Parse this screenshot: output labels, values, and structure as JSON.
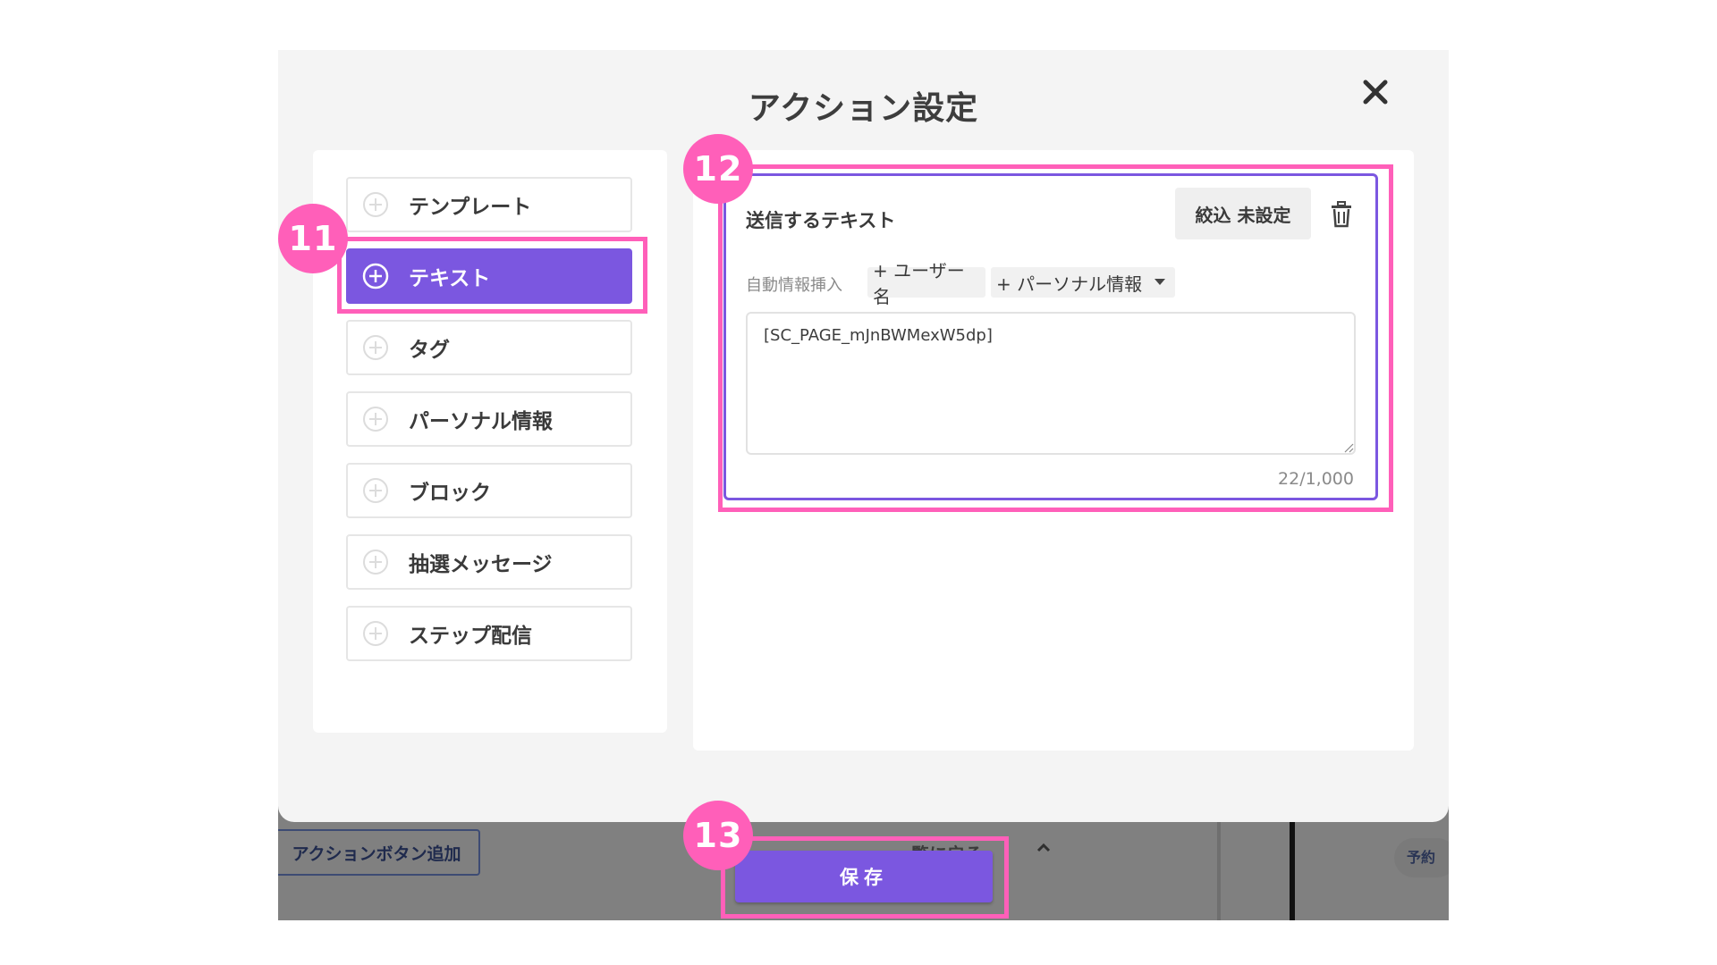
{
  "modal": {
    "title": "アクション設定"
  },
  "left_menu": {
    "items": [
      {
        "label": "テンプレート",
        "active": false
      },
      {
        "label": "テキスト",
        "active": true
      },
      {
        "label": "タグ",
        "active": false
      },
      {
        "label": "パーソナル情報",
        "active": false
      },
      {
        "label": "ブロック",
        "active": false
      },
      {
        "label": "抽選メッセージ",
        "active": false
      },
      {
        "label": "ステップ配信",
        "active": false
      }
    ]
  },
  "text_card": {
    "title": "送信するテキスト",
    "filter_label": "絞込 未設定",
    "insert_label": "自動情報挿入",
    "insert_user_name": "+ ユーザー名",
    "insert_personal_info": "+ パーソナル情報",
    "text_value": "[SC_PAGE_mJnBWMexW5dp]",
    "char_count": "22/1,000"
  },
  "footer": {
    "save_label": "保存"
  },
  "background": {
    "action_button_label": "アクションボタン追加",
    "back_label": "一覧に戻る",
    "reserve_label": "予約"
  },
  "annotations": {
    "step_11": "11",
    "step_12": "12",
    "step_13": "13"
  },
  "colors": {
    "accent": "#7b57e0",
    "highlight": "#ff5fb9",
    "overlay": "#808080"
  }
}
